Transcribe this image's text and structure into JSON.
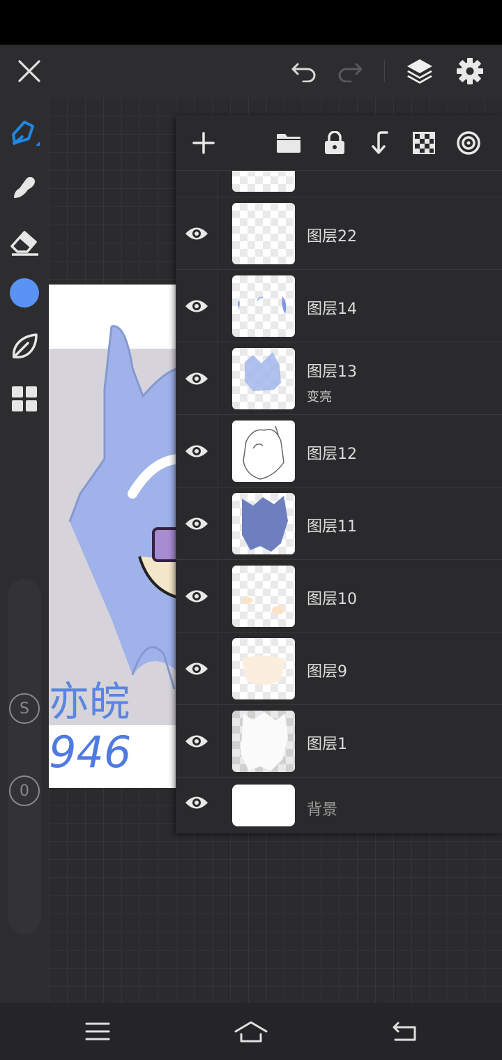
{
  "app": {
    "toolbar": {
      "close_icon": "close-icon",
      "undo_icon": "undo-icon",
      "redo_icon": "redo-icon",
      "layers_icon": "layers-icon",
      "settings_icon": "gear-icon"
    },
    "colors": {
      "accent": "#2196f3",
      "current_color": "#5b93f5",
      "panel_bg": "#2a2a2c",
      "toolbar_bg": "#2d2d2f"
    }
  },
  "left_tools": [
    {
      "name": "brush",
      "icon": "brush-icon",
      "active": true
    },
    {
      "name": "smudge",
      "icon": "smudge-icon"
    },
    {
      "name": "eraser",
      "icon": "eraser-icon"
    },
    {
      "name": "color",
      "icon": "color-swatch-icon"
    },
    {
      "name": "brush-library",
      "icon": "leaf-icon"
    },
    {
      "name": "gallery",
      "icon": "grid-icon"
    }
  ],
  "size_slider": {
    "label_top": "S",
    "label_bottom": "0"
  },
  "artwork": {
    "text_line1": "亦皖",
    "text_line2": "946"
  },
  "layers_panel": {
    "actions": [
      {
        "name": "add-layer",
        "icon": "plus-icon"
      },
      {
        "name": "new-folder",
        "icon": "folder-icon"
      },
      {
        "name": "lock-layer",
        "icon": "lock-icon"
      },
      {
        "name": "merge-down",
        "icon": "merge-down-icon"
      },
      {
        "name": "transparency",
        "icon": "checker-icon"
      },
      {
        "name": "reference",
        "icon": "target-icon"
      }
    ],
    "layers": [
      {
        "name": "图层22",
        "blend": ""
      },
      {
        "name": "图层14",
        "blend": ""
      },
      {
        "name": "图层13",
        "blend": "变亮"
      },
      {
        "name": "图层12",
        "blend": ""
      },
      {
        "name": "图层11",
        "blend": ""
      },
      {
        "name": "图层10",
        "blend": ""
      },
      {
        "name": "图层9",
        "blend": ""
      },
      {
        "name": "图层1",
        "blend": ""
      }
    ],
    "background_layer": {
      "name": "背景"
    }
  },
  "nav_bar": {
    "menu_icon": "menu-icon",
    "home_icon": "home-icon",
    "back_icon": "back-icon"
  }
}
